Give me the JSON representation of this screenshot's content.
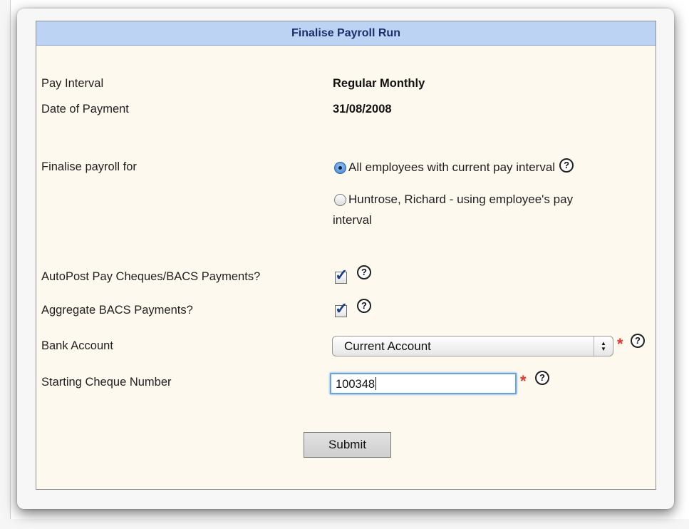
{
  "panel": {
    "title": "Finalise Payroll Run"
  },
  "fields": {
    "pay_interval": {
      "label": "Pay Interval",
      "value": "Regular Monthly"
    },
    "date_of_payment": {
      "label": "Date of Payment",
      "value": "31/08/2008"
    },
    "finalise_for": {
      "label": "Finalise payroll for",
      "options": [
        {
          "label": "All employees with current pay interval",
          "selected": true
        },
        {
          "label_line1": "Huntrose, Richard - using employee's pay",
          "label_line2": "interval",
          "selected": false
        }
      ]
    },
    "autopost": {
      "label": "AutoPost Pay Cheques/BACS Payments?",
      "checked": true
    },
    "aggregate": {
      "label": "Aggregate BACS Payments?",
      "checked": true
    },
    "bank_account": {
      "label": "Bank Account",
      "selected": "Current Account",
      "required": true
    },
    "starting_cheque": {
      "label": "Starting Cheque Number",
      "value": "100348",
      "required": true
    }
  },
  "help_glyph": "?",
  "required_glyph": "*",
  "submit_label": "Submit",
  "icons": {
    "help": "help-circle-icon",
    "required": "asterisk-icon",
    "select": "up-down-chevron-icon"
  }
}
